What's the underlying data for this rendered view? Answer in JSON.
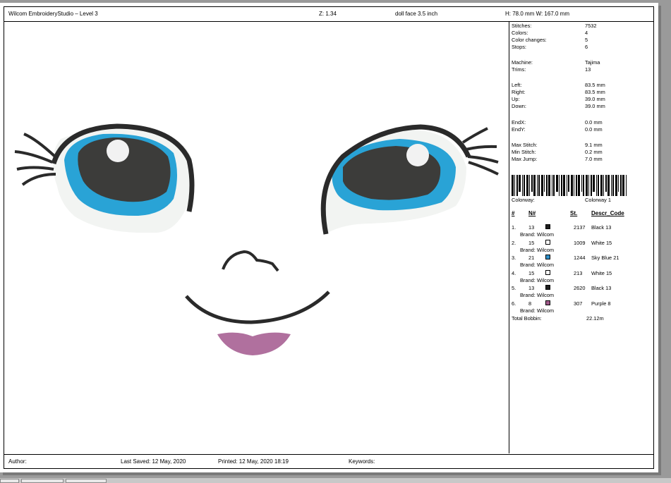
{
  "header": {
    "title": "Wilcom EmbroideryStudio – Level 3",
    "zoom": "Z: 1.34",
    "design_name": "doll face 3.5 inch",
    "dimensions": "H: 78.0 mm   W: 167.0 mm"
  },
  "stats": {
    "stitches_label": "Stitches:",
    "stitches": "7532",
    "colors_label": "Colors:",
    "colors": "4",
    "color_changes_label": "Color changes:",
    "color_changes": "5",
    "stops_label": "Stops:",
    "stops": "6",
    "machine_label": "Machine:",
    "machine": "Tajima",
    "trims_label": "Trims:",
    "trims": "13",
    "left_label": "Left:",
    "left": "83.5 mm",
    "right_label": "Right:",
    "right": "83.5 mm",
    "up_label": "Up:",
    "up": "39.0 mm",
    "down_label": "Down:",
    "down": "39.0 mm",
    "endx_label": "EndX:",
    "endx": "0.0 mm",
    "endy_label": "EndY:",
    "endy": "0.0 mm",
    "max_stitch_label": "Max Stitch:",
    "max_stitch": "9.1 mm",
    "min_stitch_label": "Min Stitch:",
    "min_stitch": "0.2 mm",
    "max_jump_label": "Max Jump:",
    "max_jump": "7.0 mm",
    "colorway_label": "Colorway:",
    "colorway": "Colorway 1"
  },
  "color_table": {
    "headers": {
      "index": "#",
      "n": "N#",
      "st": "St.",
      "descr": "Descr_Code"
    },
    "rows": [
      {
        "idx": "1.",
        "n": "13",
        "color": "#1e1e1e",
        "st": "2137",
        "descr": "Black 13",
        "brand": "Brand: Wilcom"
      },
      {
        "idx": "2.",
        "n": "15",
        "color": "#ffffff",
        "st": "1009",
        "descr": "White 15",
        "brand": "Brand: Wilcom"
      },
      {
        "idx": "3.",
        "n": "21",
        "color": "#2f8fc8",
        "st": "1244",
        "descr": "Sky Blue 21",
        "brand": "Brand: Wilcom"
      },
      {
        "idx": "4.",
        "n": "15",
        "color": "#ffffff",
        "st": "213",
        "descr": "White 15",
        "brand": "Brand: Wilcom"
      },
      {
        "idx": "5.",
        "n": "13",
        "color": "#1e1e1e",
        "st": "2620",
        "descr": "Black 13",
        "brand": "Brand: Wilcom"
      },
      {
        "idx": "6.",
        "n": "8",
        "color": "#a05a8a",
        "st": "307",
        "descr": "Purple 8",
        "brand": "Brand: Wilcom"
      }
    ],
    "total_bobbin_label": "Total Bobbin:",
    "total_bobbin": "22.12m"
  },
  "footer": {
    "author": "Author:",
    "last_saved": "Last Saved: 12 May, 2020",
    "printed": "Printed: 12 May, 2020 18:19",
    "keywords": "Keywords:"
  },
  "colors": {
    "eye_outline": "#2a2a2a",
    "iris": "#29a3d6",
    "pupil": "#3a3a3a",
    "sclera": "#f2f4f2",
    "lips": "#b0709e"
  }
}
